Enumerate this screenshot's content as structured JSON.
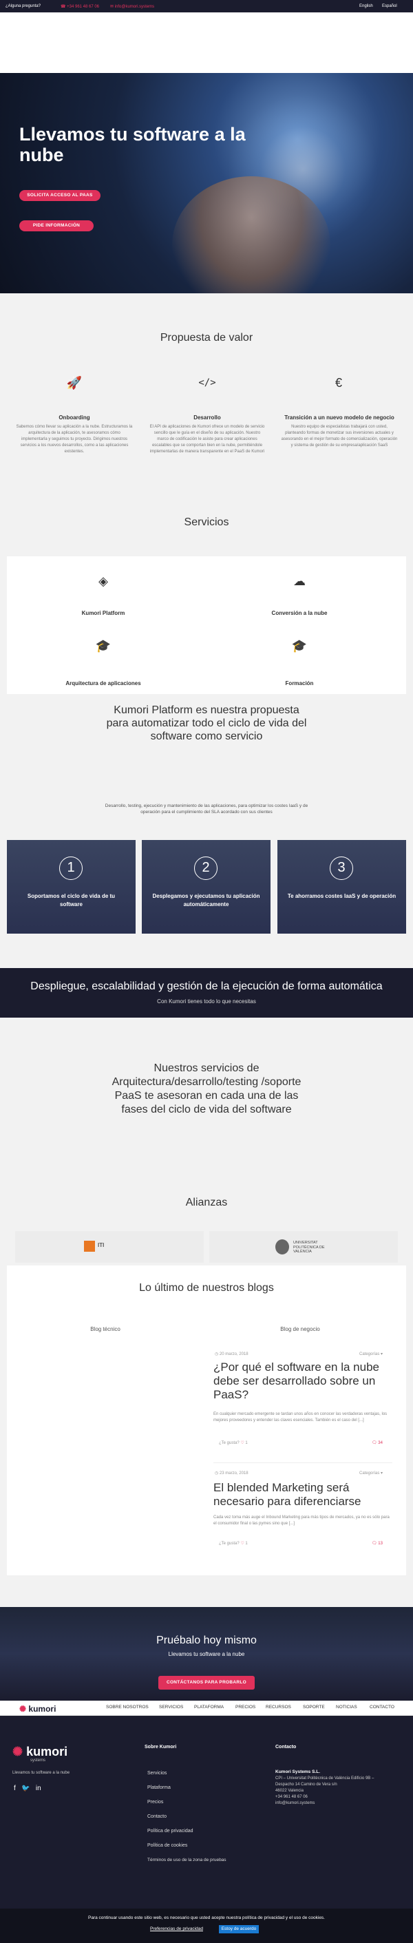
{
  "topbar": {
    "question": "¿Alguna pregunta?",
    "phone": "+34 961 48 67 06",
    "email": "info@kumori.systems",
    "lang_en": "English",
    "lang_es": "Español"
  },
  "hero": {
    "title": "Llevamos tu software a la nube",
    "btn_access": "SOLICITA ACCESO AL PAAS",
    "btn_info": "PIDE INFORMACIÓN"
  },
  "value": {
    "heading": "Propuesta de valor",
    "cols": [
      {
        "icon": "rocket-icon",
        "title": "Onboarding",
        "text": "Sabemos cómo llevar su aplicación a la nube. Estructuramos la arquitectura de la aplicación, te asesoramos cómo implementarla y seguimos tu proyecto. Dirigimos nuestros servicios a los nuevos desarrollos, como a las aplicaciones existentes."
      },
      {
        "icon": "code-icon",
        "title": "Desarrollo",
        "text": "El API de aplicaciones de Kumori ofrece un modelo de servicio sencillo que le guía en el diseño de su aplicación. Nuestro marco de codificación le asiste para crear aplicaciones escalables que se comportan bien en la nube, permitiéndole implementarlas de manera transparente en el PaaS de Kumori"
      },
      {
        "icon": "euro-icon",
        "title": "Transición a un nuevo modelo de negocio",
        "text": "Nuestro equipo de especialistas trabajará con usted, planteando formas de monetizar sus inversiones actuales y asesorando en el mejor formato de comercialización, operación y sistema de gestión de su empresa/aplicación SaaS"
      }
    ]
  },
  "services": {
    "heading": "Servicios",
    "items": [
      {
        "icon": "layers-icon",
        "label": "Kumori Platform"
      },
      {
        "icon": "cloud-icon",
        "label": "Conversión a la nube"
      },
      {
        "icon": "graduation-cap-icon",
        "label": "Arquitectura de aplicaciones"
      },
      {
        "icon": "graduation-cap-icon",
        "label": "Formación"
      }
    ]
  },
  "platform": {
    "heading": "Kumori Platform es nuestra propuesta para automatizar todo el ciclo de vida del software como servicio",
    "sub": "Desarrollo, testing, ejecución y mantenimiento de las aplicaciones, para optimizar los costes IaaS y de operación para el cumplimiento del SLA acordado con sus clientes",
    "steps": [
      {
        "num": "1",
        "title": "Soportamos el ciclo de vida de tu software"
      },
      {
        "num": "2",
        "title": "Desplegamos y ejecutamos tu aplicación automáticamente"
      },
      {
        "num": "3",
        "title": "Te ahorramos costes IaaS y de operación"
      }
    ]
  },
  "band": {
    "title": "Despliegue, escalabilidad y gestión de la ejecución de forma automática",
    "sub": "Con Kumori tienes todo lo que necesitas"
  },
  "services_text": "Nuestros servicios de Arquitectura/desarrollo/testing /soporte PaaS te asesoran en cada una de las fases del ciclo de vida del software",
  "alliances": {
    "heading": "Alianzas",
    "iti": "ITI",
    "upv": "UNIVERSITAT POLITÈCNICA DE VALÈNCIA"
  },
  "blogs": {
    "heading": "Lo último de nuestros blogs",
    "tab_tech": "Blog técnico",
    "tab_business": "Blog de negocio",
    "posts": [
      {
        "date": "20 marzo, 2018",
        "category": "Categorías",
        "title": "¿Por qué el software en la nube debe ser desarrollado sobre un PaaS?",
        "excerpt": "En cualquier mercado emergente se tardan unos años en conocer las verdaderas ventajas, los mejores proveedores y entender las claves esenciales. También es el caso del [...]",
        "like": "¿Te gusta?",
        "likes": "1",
        "comments": "34"
      },
      {
        "date": "23 marzo, 2018",
        "category": "Categorías",
        "title": "El blended Marketing será necesario para diferenciarse",
        "excerpt": "Cada vez toma más auge el Inbound Marketing para más tipos de mercados, ya no es sólo para el consumidor final o las pymes sino que [...]",
        "like": "¿Te gusta?",
        "likes": "1",
        "comments": "13"
      }
    ]
  },
  "cta": {
    "title": "Pruébalo hoy mismo",
    "sub": "Llevamos tu software a la nube",
    "button": "CONTÁCTANOS PARA PROBARLO"
  },
  "nav": {
    "logo": "kumori",
    "logo_sub": "systems",
    "items": [
      "SOBRE NOSOTROS",
      "SERVICIOS",
      "PLATAFORMA",
      "PRECIOS",
      "RECURSOS",
      "SOPORTE",
      "NOTICIAS",
      "CONTACTO"
    ]
  },
  "footer": {
    "tagline": "Llevamos tu software a la nube",
    "col1_title": "Sobre Kumori",
    "links": [
      "Servicios",
      "Plataforma",
      "Precios",
      "Contacto",
      "Política de privacidad",
      "Política de cookies",
      "Términos de uso de la zona de pruebas"
    ],
    "col2_title": "Contacto",
    "company": "Kumori Systems S.L.",
    "address1": "CPI – Universitat Politècnica de València Edificio 9B –",
    "address2": "Despacho 14 Camino de Vera s/n",
    "city": "46022 Valencia",
    "phone": "+34 961 48 67 06",
    "email": "info@kumori.systems"
  },
  "cookie": {
    "text": "Para continuar usando este sitio web, es necesario que usted acepte nuestra política de privacidad y el uso de cookies.",
    "prefs": "Preferencias de privacidad",
    "agree": "Estoy de acuerdo"
  },
  "colors": {
    "accent": "#e0315b",
    "dark": "#1b1c2e"
  }
}
